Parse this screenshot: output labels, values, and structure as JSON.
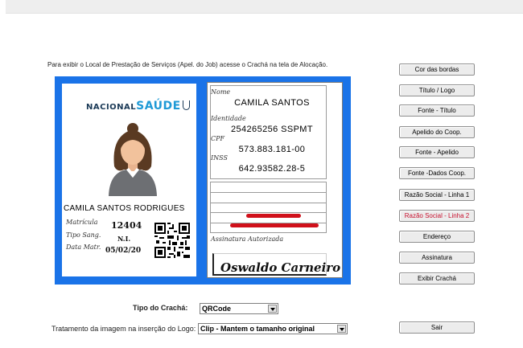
{
  "info_text": "Para exibir o Local de Prestação de Serviços (Apel. do Job) acesse o Crachá na tela de Alocação.",
  "card": {
    "border_color": "#1a73e8",
    "front": {
      "logo_part1": "NACIONAL",
      "logo_part2": "SAÚDE",
      "full_name": "CAMILA SANTOS RODRIGUES",
      "matricula_label": "Matrícula",
      "matricula_value": "12404",
      "tipo_sang_label": "Tipo Sang.",
      "tipo_sang_value": "N.I.",
      "data_matr_label": "Data Matr.",
      "data_matr_value": "05/02/20"
    },
    "back": {
      "nome_label": "Nome",
      "nome_value": "CAMILA SANTOS",
      "identidade_label": "Identidade",
      "identidade_value": "254265256  SSPMT",
      "cpf_label": "CPF",
      "cpf_value": "573.883.181-00",
      "inss_label": "INSS",
      "inss_value": "642.93582.28-5",
      "assinatura_label": "Assinatura Autorizada",
      "signature_text": "Oswaldo Carneiro"
    }
  },
  "buttons": [
    {
      "label": "Cor das bordas",
      "color": "#000000"
    },
    {
      "label": "Título / Logo",
      "color": "#000000"
    },
    {
      "label": "Fonte - Título",
      "color": "#000000"
    },
    {
      "label": "Apelido do Coop.",
      "color": "#000000"
    },
    {
      "label": "Fonte - Apelido",
      "color": "#000000"
    },
    {
      "label": "Fonte -Dados Coop.",
      "color": "#000000"
    },
    {
      "label": "Razão Social - Linha 1",
      "color": "#000000"
    },
    {
      "label": "Razão Social - Linha 2",
      "color": "#c8102e"
    },
    {
      "label": "Endereço",
      "color": "#000000"
    },
    {
      "label": "Assinatura",
      "color": "#000000"
    },
    {
      "label": "Exibir Crachá",
      "color": "#000000"
    }
  ],
  "tipo_cracha": {
    "label": "Tipo do Crachá:",
    "value": "QRCode"
  },
  "tratamento": {
    "label": "Tratamento da imagem na inserção do Logo:",
    "value": "Clip - Mantem o tamanho original"
  },
  "sair_label": "Sair"
}
